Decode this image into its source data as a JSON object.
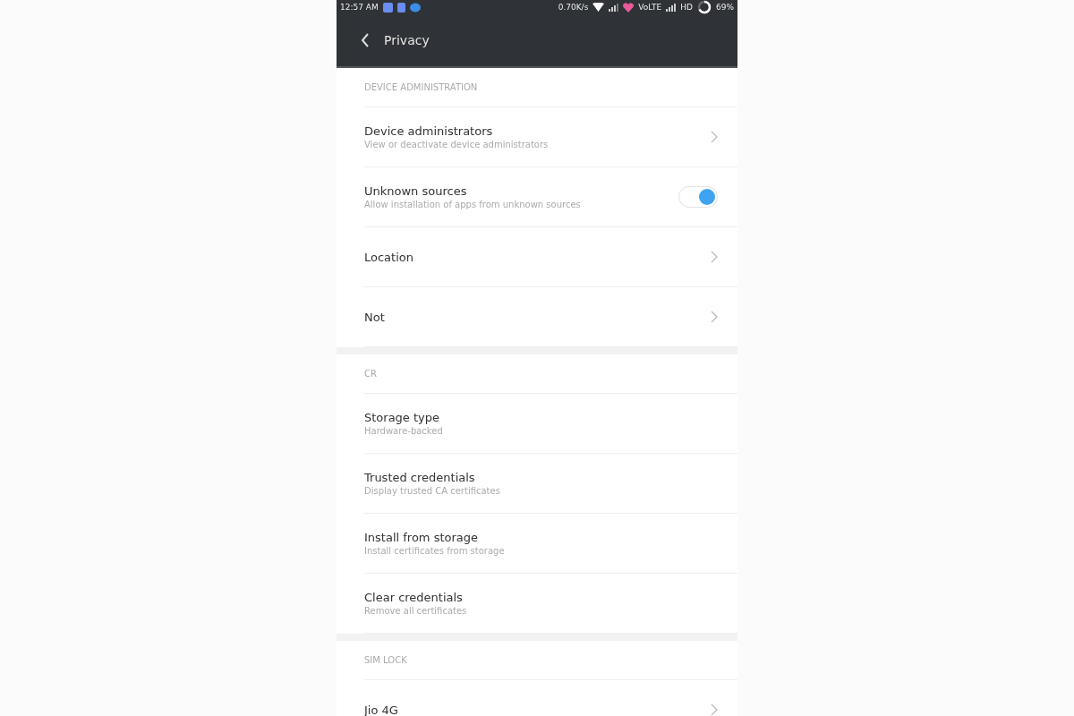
{
  "status_bar": {
    "time": "12:57 AM",
    "speed": "0.70K/s",
    "network": "VoLTE",
    "hd": "HD",
    "battery": "69%"
  },
  "toolbar": {
    "title": "Privacy"
  },
  "sections": [
    {
      "header": "DEVICE ADMINISTRATION",
      "items": [
        {
          "kind": "link",
          "title": "Device administrators",
          "subtitle": "View or deactivate device administrators"
        },
        {
          "kind": "toggle",
          "title": "Unknown sources",
          "subtitle": "Allow installation of apps from unknown sources",
          "on": true
        },
        {
          "kind": "link",
          "title": "Location"
        },
        {
          "kind": "link",
          "title": "Not"
        }
      ]
    },
    {
      "header": "CR",
      "items": [
        {
          "kind": "info",
          "title": "Storage type",
          "subtitle": "Hardware-backed"
        },
        {
          "kind": "info",
          "title": "Trusted credentials",
          "subtitle": "Display trusted CA certificates"
        },
        {
          "kind": "info",
          "title": "Install from storage",
          "subtitle": "Install certificates from storage"
        },
        {
          "kind": "info",
          "title": "Clear credentials",
          "subtitle": "Remove all certificates"
        }
      ]
    },
    {
      "header": "SIM LOCK",
      "items": [
        {
          "kind": "link",
          "title": "Jio 4G"
        }
      ]
    }
  ]
}
